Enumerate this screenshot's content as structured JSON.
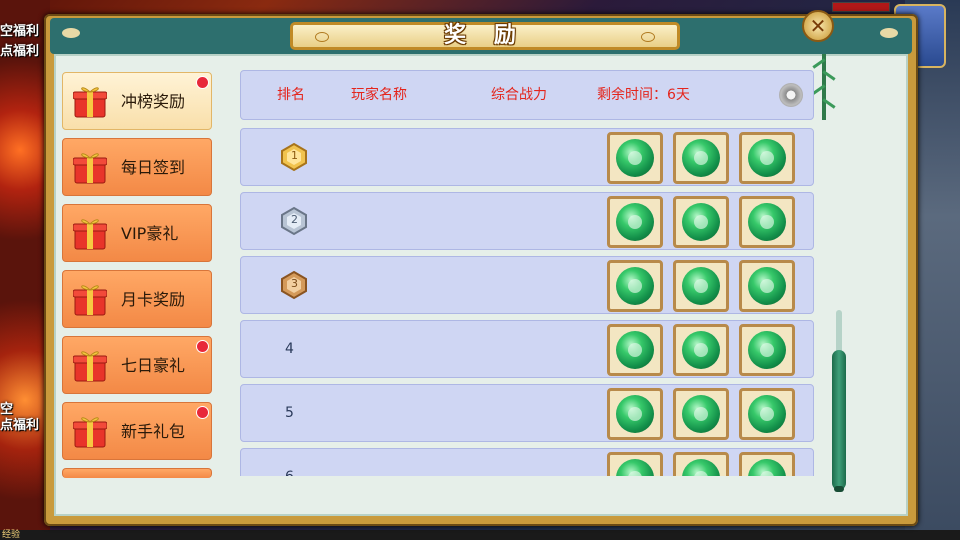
{
  "background": {
    "left_text_top": "空福利",
    "left_text_top2": "点福利",
    "left_text_mid": "空",
    "left_text_mid2": "点福利",
    "exp_label": "经验"
  },
  "panel": {
    "title": "奖 励"
  },
  "sidebar": {
    "tabs": [
      {
        "label": "冲榜奖励",
        "active": true,
        "badge": true
      },
      {
        "label": "每日签到",
        "active": false,
        "badge": false
      },
      {
        "label": "VIP豪礼",
        "active": false,
        "badge": false
      },
      {
        "label": "月卡奖励",
        "active": false,
        "badge": false
      },
      {
        "label": "七日豪礼",
        "active": false,
        "badge": true
      },
      {
        "label": "新手礼包",
        "active": false,
        "badge": true
      }
    ]
  },
  "ranking": {
    "headers": {
      "rank": "排名",
      "player": "玩家名称",
      "power": "综合战力",
      "time_left": "剩余时间：6天"
    },
    "rows": [
      {
        "rank": "1",
        "medal": "gold-medal-icon"
      },
      {
        "rank": "2",
        "medal": "silver-medal-icon"
      },
      {
        "rank": "3",
        "medal": "bronze-medal-icon"
      },
      {
        "rank": "4"
      },
      {
        "rank": "5"
      },
      {
        "rank": "6"
      }
    ],
    "reward_icon": "jade-pendant-icon"
  },
  "colors": {
    "header_text": "#e4251c",
    "tab_orange": "#f38946",
    "tab_active": "#f9dfaa",
    "panel_teal": "#2d6f6e",
    "row_bg": "#cfd6f3"
  }
}
